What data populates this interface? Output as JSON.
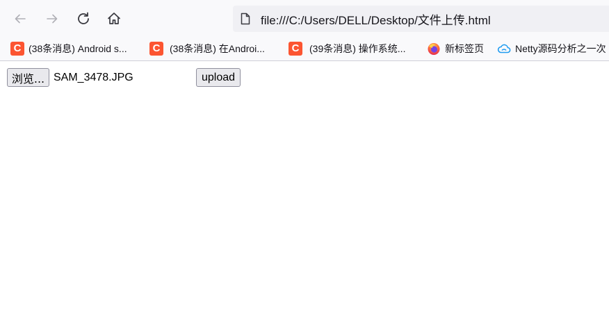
{
  "browser": {
    "url": "file:///C:/Users/DELL/Desktop/文件上传.html",
    "icons": {
      "back": "back-arrow-icon",
      "forward": "forward-arrow-icon",
      "reload": "reload-icon",
      "home": "home-icon",
      "page": "page-icon"
    }
  },
  "bookmarks": [
    {
      "label": "(38条消息) Android s...",
      "icon": "csdn-icon"
    },
    {
      "label": "(38条消息) 在Androi...",
      "icon": "csdn-icon"
    },
    {
      "label": "(39条消息) 操作系统...",
      "icon": "csdn-icon"
    },
    {
      "label": "新标签页",
      "icon": "firefox-icon"
    },
    {
      "label": "Netty源码分析之一次",
      "icon": "cloud-icon"
    }
  ],
  "form": {
    "browse_label": "浏览...",
    "file_name": "SAM_3478.JPG",
    "upload_label": "upload"
  },
  "colors": {
    "csdn": "#fc5531",
    "toolbar_bg": "#f9f9fb",
    "urlbar_bg": "#f0f0f4"
  }
}
